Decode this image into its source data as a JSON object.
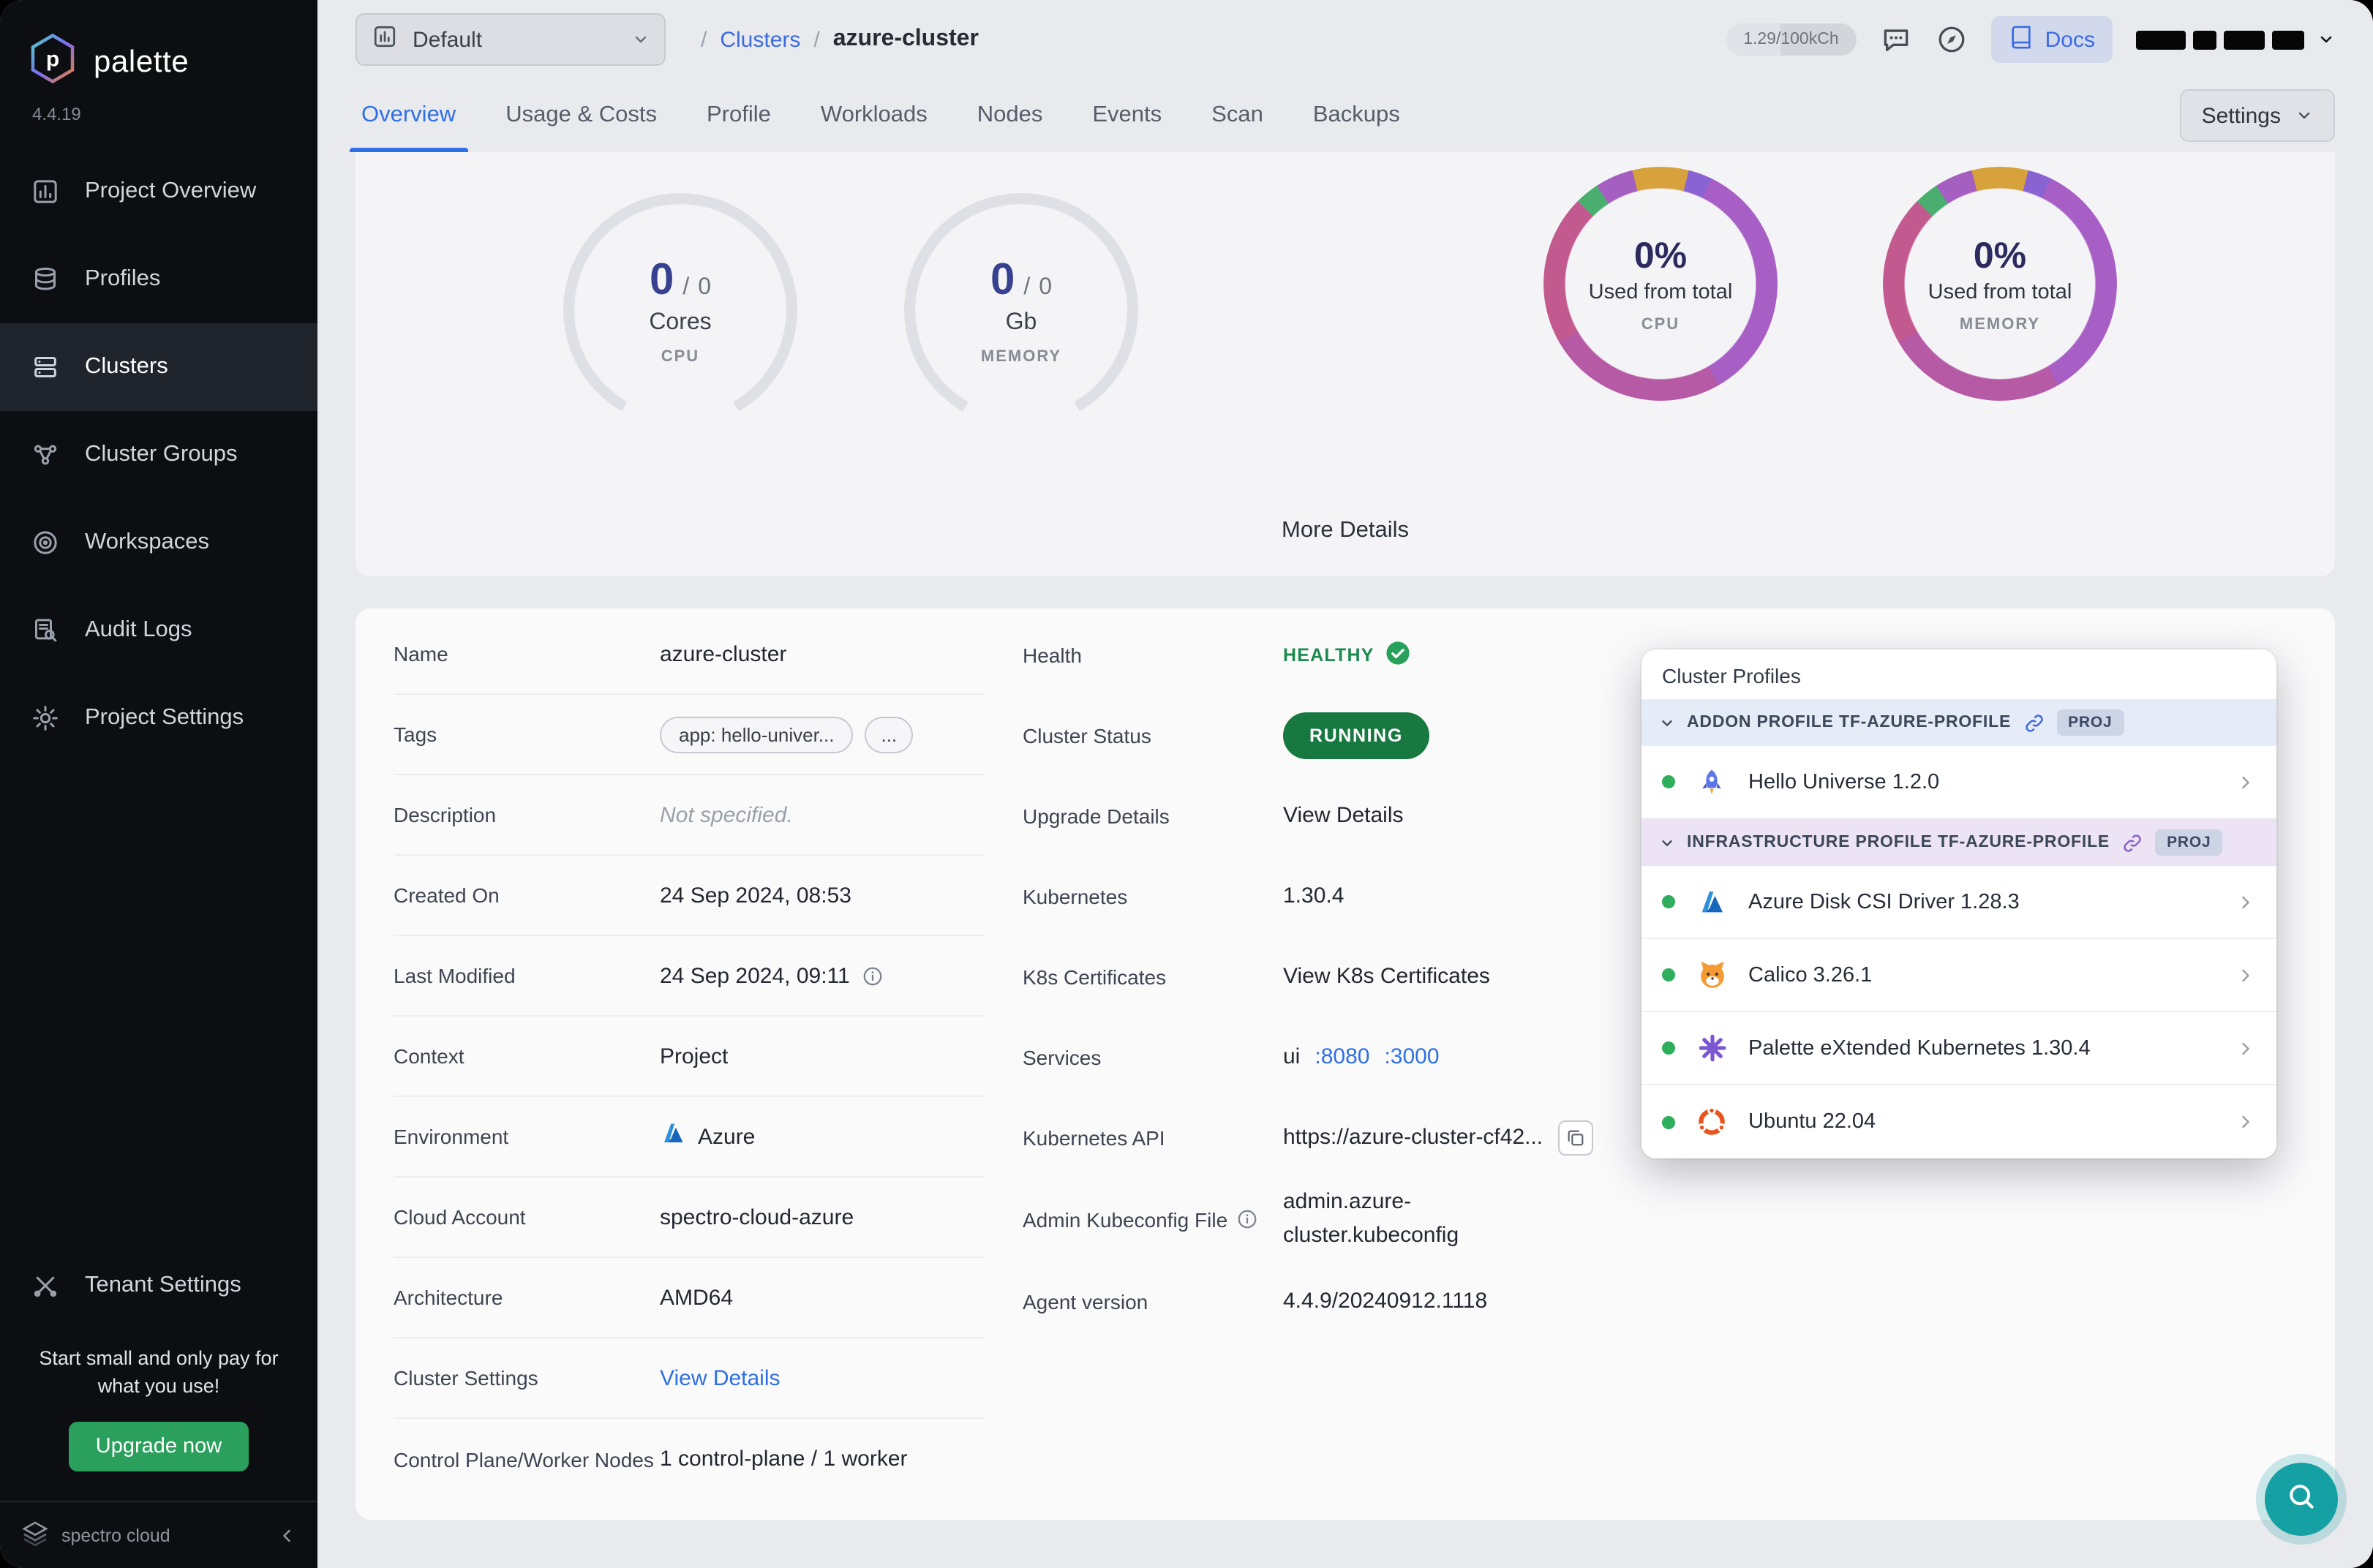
{
  "colors": {
    "accent_blue": "#2f6fe4",
    "healthy_green": "#1d8a4e",
    "running_bg": "#17793f",
    "upgrade_green": "#2aa05c",
    "teal_fab": "#15a0a3",
    "donut_purple": "#a75fc6",
    "donut_magenta": "#c25a90",
    "sidebar_bg": "#0c0e12",
    "page_bg": "#e9eaee"
  },
  "sidebar": {
    "logo_text": "palette",
    "version": "4.4.19",
    "items": [
      {
        "label": "Project Overview"
      },
      {
        "label": "Profiles"
      },
      {
        "label": "Clusters"
      },
      {
        "label": "Cluster Groups"
      },
      {
        "label": "Workspaces"
      },
      {
        "label": "Audit Logs"
      },
      {
        "label": "Project Settings"
      }
    ],
    "tenant_label": "Tenant Settings",
    "promo": "Start small and only pay for what you use!",
    "upgrade_label": "Upgrade now",
    "brand": "spectro cloud"
  },
  "header": {
    "project_selector": "Default",
    "breadcrumb": {
      "sep": "/",
      "link": "Clusters",
      "current": "azure-cluster"
    },
    "usage": "1.29/100kCh",
    "docs_label": "Docs"
  },
  "tabs": {
    "items": [
      {
        "label": "Overview"
      },
      {
        "label": "Usage & Costs"
      },
      {
        "label": "Profile"
      },
      {
        "label": "Workloads"
      },
      {
        "label": "Nodes"
      },
      {
        "label": "Events"
      },
      {
        "label": "Scan"
      },
      {
        "label": "Backups"
      }
    ],
    "settings_label": "Settings"
  },
  "metrics": {
    "sep": "/",
    "gauges": [
      {
        "value": "0",
        "total": "0",
        "unit": "Cores",
        "caption": "CPU"
      },
      {
        "value": "0",
        "total": "0",
        "unit": "Gb",
        "caption": "MEMORY"
      }
    ],
    "donuts": [
      {
        "pct": "0%",
        "line": "Used from total",
        "caption": "CPU"
      },
      {
        "pct": "0%",
        "line": "Used from total",
        "caption": "MEMORY"
      }
    ],
    "more_details": "More Details"
  },
  "details": {
    "left": [
      {
        "label": "Name",
        "value": "azure-cluster"
      },
      {
        "label": "Tags",
        "chip": "app: hello-univer...",
        "more": "..."
      },
      {
        "label": "Description",
        "value": "Not specified."
      },
      {
        "label": "Created On",
        "value": "24 Sep 2024, 08:53"
      },
      {
        "label": "Last Modified",
        "value": "24 Sep 2024, 09:11"
      },
      {
        "label": "Context",
        "value": "Project"
      },
      {
        "label": "Environment",
        "value": "Azure"
      },
      {
        "label": "Cloud Account",
        "value": "spectro-cloud-azure"
      },
      {
        "label": "Architecture",
        "value": "AMD64"
      },
      {
        "label": "Cluster Settings",
        "value": "View Details"
      },
      {
        "label": "Control Plane/Worker Nodes",
        "value": "1 control-plane / 1 worker"
      }
    ],
    "right": [
      {
        "label": "Health",
        "value": "HEALTHY"
      },
      {
        "label": "Cluster Status",
        "value": "RUNNING"
      },
      {
        "label": "Upgrade Details",
        "value": "View Details"
      },
      {
        "label": "Kubernetes",
        "value": "1.30.4"
      },
      {
        "label": "K8s Certificates",
        "value": "View K8s Certificates"
      },
      {
        "label": "Services",
        "value": "ui",
        "port1": ":8080",
        "port2": ":3000"
      },
      {
        "label": "Kubernetes API",
        "value": "https://azure-cluster-cf42..."
      },
      {
        "label": "Admin Kubeconfig File",
        "value": "admin.azure-cluster.kubeconfig"
      },
      {
        "label": "Agent version",
        "value": "4.4.9/20240912.1118"
      }
    ]
  },
  "cluster_profiles": {
    "title": "Cluster Profiles",
    "sections": [
      {
        "header": "ADDON PROFILE TF-AZURE-PROFILE",
        "badge": "PROJ",
        "items": [
          {
            "name": "Hello Universe 1.2.0"
          }
        ]
      },
      {
        "header": "INFRASTRUCTURE PROFILE TF-AZURE-PROFILE",
        "badge": "PROJ",
        "items": [
          {
            "name": "Azure Disk CSI Driver 1.28.3"
          },
          {
            "name": "Calico 3.26.1"
          },
          {
            "name": "Palette eXtended Kubernetes 1.30.4"
          },
          {
            "name": "Ubuntu 22.04"
          }
        ]
      }
    ]
  }
}
